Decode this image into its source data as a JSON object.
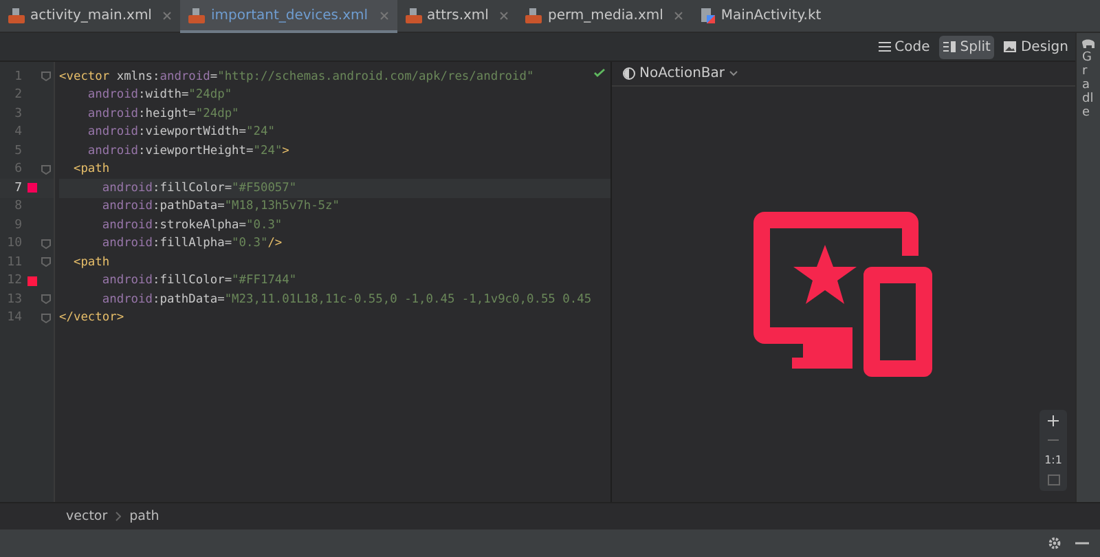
{
  "tabs": [
    {
      "label": "activity_main.xml",
      "kind": "xml",
      "selected": false
    },
    {
      "label": "important_devices.xml",
      "kind": "xml",
      "selected": true
    },
    {
      "label": "attrs.xml",
      "kind": "xml",
      "selected": false
    },
    {
      "label": "perm_media.xml",
      "kind": "xml",
      "selected": false
    },
    {
      "label": "MainActivity.kt",
      "kind": "kotlin",
      "selected": false
    }
  ],
  "view_modes": [
    {
      "label": "Code",
      "kind": "code",
      "selected": false
    },
    {
      "label": "Split",
      "kind": "split",
      "selected": true
    },
    {
      "label": "Design",
      "kind": "design",
      "selected": false
    }
  ],
  "gradle_label": "Gradle",
  "editor": {
    "lines": [
      {
        "number": "1",
        "fold": true,
        "current": false,
        "tokens": [
          {
            "text": "<vector ",
            "kind": "tag"
          },
          {
            "text": "xmlns:",
            "kind": "plain"
          },
          {
            "text": "android",
            "kind": "ns"
          },
          {
            "text": "=",
            "kind": "punct"
          },
          {
            "text": "\"http://schemas.android.com/apk/res/android\"",
            "kind": "string"
          }
        ]
      },
      {
        "number": "2",
        "fold": false,
        "current": false,
        "tokens": [
          {
            "text": "    android",
            "kind": "ns"
          },
          {
            "text": ":width",
            "kind": "plain"
          },
          {
            "text": "=",
            "kind": "punct"
          },
          {
            "text": "\"24dp\"",
            "kind": "string"
          }
        ]
      },
      {
        "number": "3",
        "fold": false,
        "current": false,
        "tokens": [
          {
            "text": "    android",
            "kind": "ns"
          },
          {
            "text": ":height",
            "kind": "plain"
          },
          {
            "text": "=",
            "kind": "punct"
          },
          {
            "text": "\"24dp\"",
            "kind": "string"
          }
        ]
      },
      {
        "number": "4",
        "fold": false,
        "current": false,
        "tokens": [
          {
            "text": "    android",
            "kind": "ns"
          },
          {
            "text": ":viewportWidth",
            "kind": "plain"
          },
          {
            "text": "=",
            "kind": "punct"
          },
          {
            "text": "\"24\"",
            "kind": "string"
          }
        ]
      },
      {
        "number": "5",
        "fold": false,
        "current": false,
        "tokens": [
          {
            "text": "    android",
            "kind": "ns"
          },
          {
            "text": ":viewportHeight",
            "kind": "plain"
          },
          {
            "text": "=",
            "kind": "punct"
          },
          {
            "text": "\"24\"",
            "kind": "string"
          },
          {
            "text": ">",
            "kind": "tag"
          }
        ]
      },
      {
        "number": "6",
        "fold": true,
        "current": false,
        "tokens": [
          {
            "text": "  <path",
            "kind": "tag"
          }
        ]
      },
      {
        "number": "7",
        "fold": false,
        "current": true,
        "color": "#f50057",
        "tokens": [
          {
            "text": "      android",
            "kind": "ns"
          },
          {
            "text": ":fillColor",
            "kind": "plain"
          },
          {
            "text": "=",
            "kind": "punct"
          },
          {
            "text": "\"#F50057\"",
            "kind": "string"
          }
        ]
      },
      {
        "number": "8",
        "fold": false,
        "current": false,
        "tokens": [
          {
            "text": "      android",
            "kind": "ns"
          },
          {
            "text": ":pathData",
            "kind": "plain"
          },
          {
            "text": "=",
            "kind": "punct"
          },
          {
            "text": "\"M18,13h5v7h-5z\"",
            "kind": "string"
          }
        ]
      },
      {
        "number": "9",
        "fold": false,
        "current": false,
        "tokens": [
          {
            "text": "      android",
            "kind": "ns"
          },
          {
            "text": ":strokeAlpha",
            "kind": "plain"
          },
          {
            "text": "=",
            "kind": "punct"
          },
          {
            "text": "\"0.3\"",
            "kind": "string"
          }
        ]
      },
      {
        "number": "10",
        "fold": true,
        "current": false,
        "tokens": [
          {
            "text": "      android",
            "kind": "ns"
          },
          {
            "text": ":fillAlpha",
            "kind": "plain"
          },
          {
            "text": "=",
            "kind": "punct"
          },
          {
            "text": "\"0.3\"",
            "kind": "string"
          },
          {
            "text": "/>",
            "kind": "tag"
          }
        ]
      },
      {
        "number": "11",
        "fold": true,
        "current": false,
        "tokens": [
          {
            "text": "  <path",
            "kind": "tag"
          }
        ]
      },
      {
        "number": "12",
        "fold": false,
        "current": false,
        "color": "#ff1744",
        "tokens": [
          {
            "text": "      android",
            "kind": "ns"
          },
          {
            "text": ":fillColor",
            "kind": "plain"
          },
          {
            "text": "=",
            "kind": "punct"
          },
          {
            "text": "\"#FF1744\"",
            "kind": "string"
          }
        ]
      },
      {
        "number": "13",
        "fold": true,
        "current": false,
        "tokens": [
          {
            "text": "      android",
            "kind": "ns"
          },
          {
            "text": ":pathData",
            "kind": "plain"
          },
          {
            "text": "=",
            "kind": "punct"
          },
          {
            "text": "\"M23,11.01L18,11c-0.55,0 -1,0.45 -1,1v9c0,0.55 0.45",
            "kind": "string"
          }
        ]
      },
      {
        "number": "14",
        "fold": true,
        "current": false,
        "tokens": [
          {
            "text": "</vector>",
            "kind": "tag"
          }
        ]
      }
    ]
  },
  "preview": {
    "theme": "NoActionBar",
    "zoom_reset": "1:1"
  },
  "breadcrumb": [
    "vector",
    "path"
  ]
}
